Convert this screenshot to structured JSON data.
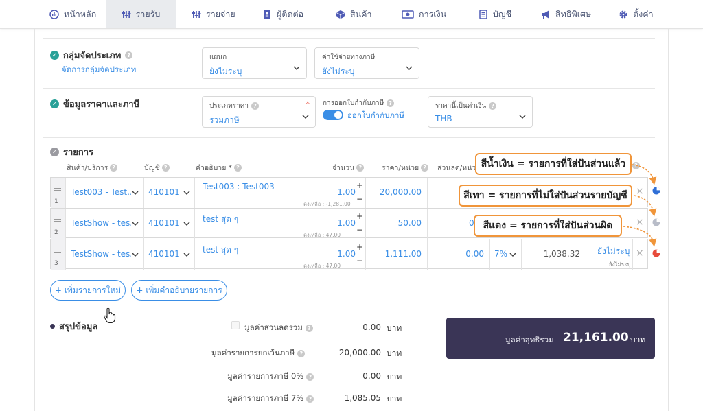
{
  "nav": {
    "items": [
      {
        "label": "หน้าหลัก",
        "icon": "dashboard-icon"
      },
      {
        "label": "รายรับ",
        "icon": "sliders-icon",
        "active": true
      },
      {
        "label": "รายจ่าย",
        "icon": "sliders-icon"
      },
      {
        "label": "ผู้ติดต่อ",
        "icon": "contact-book-icon"
      },
      {
        "label": "สินค้า",
        "icon": "box-icon"
      },
      {
        "label": "การเงิน",
        "icon": "money-icon"
      },
      {
        "label": "บัญชี",
        "icon": "ledger-icon"
      },
      {
        "label": "สิทธิพิเศษ",
        "icon": "megaphone-icon"
      },
      {
        "label": "ตั้งค่า",
        "icon": "gear-icon"
      }
    ]
  },
  "category_group": {
    "title": "กลุ่มจัดประเภท",
    "manage_link": "จัดการกลุ่มจัดประเภท",
    "department": {
      "label": "แผนก",
      "value": "ยังไม่ระบุ"
    },
    "tax_expense": {
      "label": "ค่าใช้จ่ายทางภาษี",
      "value": "ยังไม่ระบุ"
    }
  },
  "pricing": {
    "title": "ข้อมูลราคาและภาษี",
    "price_type": {
      "label": "ประเภทราคา",
      "value": "รวมภาษี"
    },
    "tax_invoice": {
      "label": "การออกใบกำกับภาษี",
      "toggle_label": "ออกใบกำกับภาษี"
    },
    "currency": {
      "label": "ราคานี้เป็นค่าเงิน",
      "value": "THB"
    }
  },
  "items": {
    "title": "รายการ",
    "headers": {
      "product": "สินค้า/บริการ",
      "account": "บัญชี",
      "description": "คำอธิบาย *",
      "qty": "จำนวน",
      "unit_price": "ราคา/หน่วย",
      "discount": "ส่วนลด/หน่ว"
    },
    "rows": [
      {
        "num": "1",
        "product": "Test003 - Test...",
        "account": "410101",
        "description": "Test003 : Test003",
        "qty": "1.00",
        "remaining": "คงเหลือ : -1,281.00",
        "price": "20,000.00"
      },
      {
        "num": "2",
        "product": "TestShow - tes...",
        "account": "410101",
        "description": "test สุด ๆ",
        "qty": "1.00",
        "remaining": "คงเหลือ : 47.00",
        "price": "50.00",
        "discount": "0"
      },
      {
        "num": "3",
        "product": "TestShow - tes...",
        "account": "410101",
        "description": "test สุด ๆ",
        "qty": "1.00",
        "remaining": "คงเหลือ : 47.00",
        "price": "1,111.00",
        "discount": "0.00",
        "vat": "7%",
        "amount": "1,038.32",
        "allocation": "ยังไม่ระบุ",
        "allocation_sub": "ยังไม่ระบุ"
      }
    ],
    "add_item_label": "เพิ่มรายการใหม่",
    "add_desc_label": "เพิ่มคำอธิบายรายการ"
  },
  "callouts": {
    "blue": "สีน้ำเงิน = รายการที่ใส่ปันส่วนแล้ว",
    "grey": "สีเทา = รายการที่ไม่ใส่ปันส่วนรายบัญชี",
    "red": "สีแดง = รายการที่ใส่ปันส่วนผิด"
  },
  "summary": {
    "title": "สรุปข้อมูล",
    "lines": [
      {
        "label": "มูลค่าส่วนลดรวม",
        "value": "0.00",
        "unit": "บาท"
      },
      {
        "label": "มูลค่ารายการยกเว้นภาษี",
        "value": "20,000.00",
        "unit": "บาท"
      },
      {
        "label": "มูลค่ารายการภาษี 0%",
        "value": "0.00",
        "unit": "บาท"
      },
      {
        "label": "มูลค่ารายการภาษี 7%",
        "value": "1,085.05",
        "unit": "บาท"
      }
    ],
    "net_total": {
      "label": "มูลค่าสุทธิรวม",
      "value": "21,161.00",
      "unit": "บาท"
    }
  },
  "colors": {
    "accent": "#3a8ee6",
    "allocated": "#2f6fd6",
    "unallocated": "#b8bcc8",
    "wrong": "#e74c3c",
    "callout_border": "#f0953a",
    "total_bg": "#3a3556"
  }
}
